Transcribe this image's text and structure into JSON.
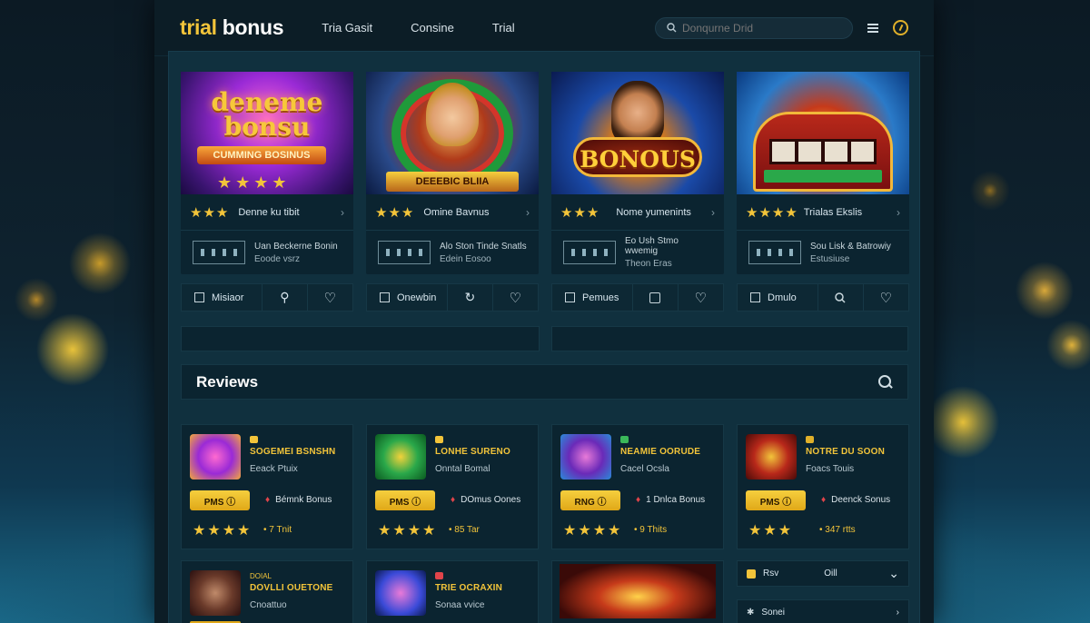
{
  "app": {
    "logo_part1": "trial",
    "logo_part2": "bonus"
  },
  "nav": [
    "Tria Gasit",
    "Consine",
    "Trial"
  ],
  "search": {
    "placeholder": "Donqurne Drid"
  },
  "featured": [
    {
      "thumb_text": "deneme bonsu",
      "thumb_sub": "CUMMING BOSINUS",
      "rating_label": "Denne ku tibit",
      "info_line1": "Uan Beckerne Bonin",
      "info_line2": "Eoode vsrz",
      "action_label": "Misiaor",
      "action_icon": "pin-icon"
    },
    {
      "thumb_text": "",
      "thumb_sub": "DEEEBIC BLIIA",
      "rating_label": "Omine Bavnus",
      "info_line1": "Alo Ston Tinde Snatls",
      "info_line2": "Edein Eosoo",
      "action_label": "Onewbin",
      "action_icon": "rotate-icon"
    },
    {
      "thumb_text": "BONOUS",
      "thumb_sub": "",
      "rating_label": "Nome yumenints",
      "info_line1": "Eo Ush Stmo wwemig",
      "info_line2": "Theon Eras",
      "action_label": "Pemues",
      "action_icon": "square-icon"
    },
    {
      "thumb_text": "",
      "thumb_sub": "",
      "rating_label": "Trialas Ekslis",
      "info_line1": "Sou Lisk & Batrowiy",
      "info_line2": "Estusiuse",
      "action_label": "Dmulo",
      "action_icon": "search-icon"
    }
  ],
  "reviews": {
    "title": "Reviews",
    "cards": [
      {
        "title": "SOGEMEI BSNSHN",
        "sub": "Eeack Ptuix",
        "play": "PMS ⓘ",
        "bonus": "Bémnk Bonus",
        "score": "• 7 Tnit",
        "tag_color": "#f2c43a"
      },
      {
        "title": "LONHE SURENO",
        "sub": "Onntal Bomal",
        "play": "PMS ⓘ",
        "bonus": "DOmus Oones",
        "score": "• 85 Tar",
        "tag_color": "#f2c43a"
      },
      {
        "title": "NEAMIE OORUDE",
        "sub": "Cacel Ocsla",
        "play": "RNG ⓘ",
        "bonus": "1 Dnlca Bonus",
        "score": "• 9 Thits",
        "tag_color": "#3ab85a"
      },
      {
        "title": "NOTRE DU SOON",
        "sub": "Foacs Touis",
        "play": "PMS ⓘ",
        "bonus": "Deenck Sonus",
        "score": "• 347 rtts",
        "tag_color": "#e0b02a"
      }
    ],
    "lower": [
      {
        "tag": "DOIAL",
        "title": "DOVLLI OUETONE",
        "sub": "Cnoattuo"
      },
      {
        "tag": "",
        "title": "TRIE OCRAXIN",
        "sub": "Sonaa vvice"
      }
    ],
    "side_panel": {
      "row1_label": "Rsv",
      "row1_value": "Oill",
      "row2_label": "Sonei"
    }
  },
  "colors": {
    "accent_gold": "#f2c43a",
    "panel": "#10303e",
    "card": "#0b2430"
  }
}
